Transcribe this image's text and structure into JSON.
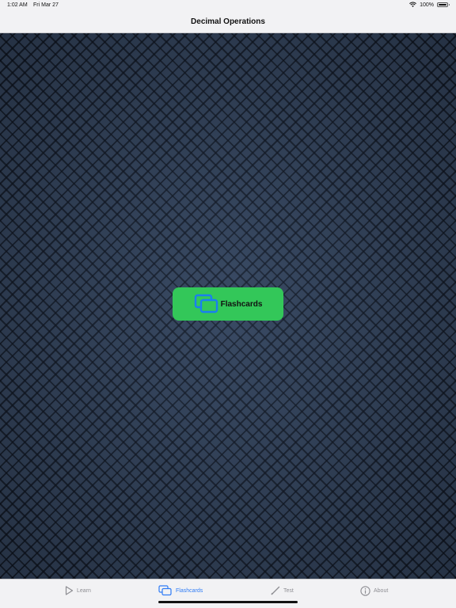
{
  "status_bar": {
    "time": "1:02 AM",
    "date": "Fri Mar 27",
    "battery": "100%"
  },
  "nav": {
    "title": "Decimal Operations"
  },
  "main": {
    "flashcards_button": {
      "label": "Flashcards",
      "icon": "cards-icon",
      "color": "#33c759"
    }
  },
  "tab_bar": {
    "active_color": "#2f7cf6",
    "inactive_color": "#8e8e93",
    "tabs": [
      {
        "label": "Learn",
        "icon": "play-icon",
        "active": false
      },
      {
        "label": "Flashcards",
        "icon": "cards-icon",
        "active": true
      },
      {
        "label": "Test",
        "icon": "pencil-icon",
        "active": false
      },
      {
        "label": "About",
        "icon": "info-icon",
        "active": false
      }
    ]
  }
}
